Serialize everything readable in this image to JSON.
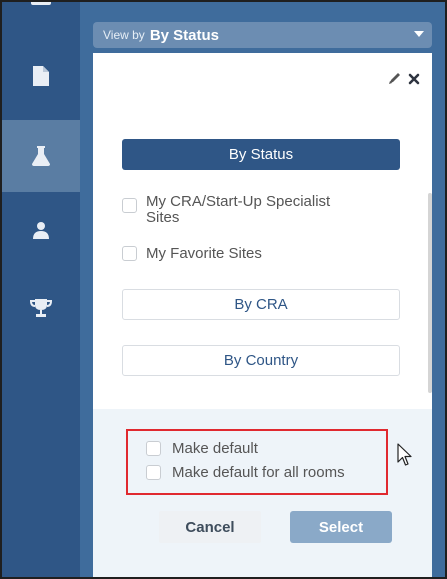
{
  "view_by": {
    "prefix": "View by",
    "value": "By Status"
  },
  "sidebar": {
    "icons": [
      "users-icon",
      "document-icon",
      "flask-icon",
      "person-icon",
      "trophy-icon"
    ],
    "active_index": 2
  },
  "dialog": {
    "tools": {
      "edit_icon": "pencil-icon",
      "close_icon": "close-icon"
    },
    "primary_option": "By Status",
    "checkboxes": [
      {
        "label_line1": "My CRA/Start-Up Specialist",
        "label_line2": "Sites",
        "checked": false
      },
      {
        "label_line1": "My Favorite Sites",
        "checked": false
      }
    ],
    "options": [
      "By CRA",
      "By Country"
    ],
    "defaults": {
      "make_default": "Make default",
      "make_default_all": "Make default for all rooms"
    },
    "cancel_label": "Cancel",
    "select_label": "Select"
  },
  "colors": {
    "sidebar": "#2f5686",
    "accent": "#2f5686",
    "highlight": "#e0292f",
    "select_button": "#8aa9c8"
  }
}
